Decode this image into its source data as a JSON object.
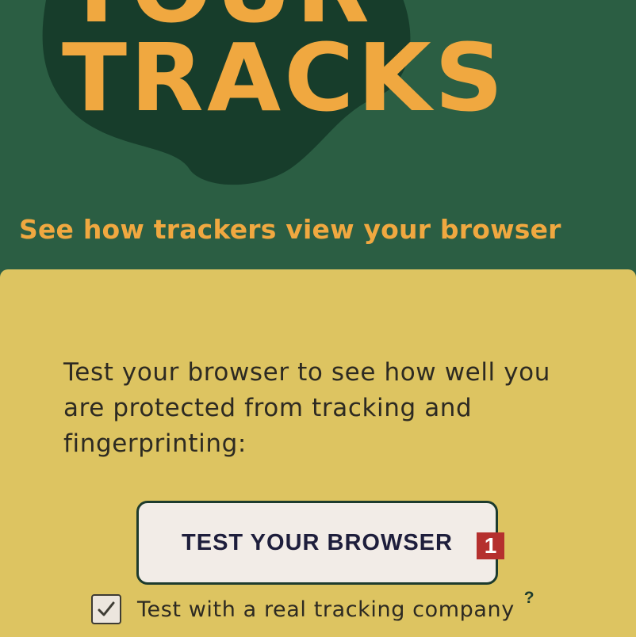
{
  "hero": {
    "title_line1": "YOUR",
    "title_line2": "TRACKS",
    "subtitle": "See how trackers view your browser"
  },
  "panel": {
    "description": "Test your browser to see how well you are protected from tracking and fingerprinting:",
    "test_button_label": "TEST YOUR BROWSER",
    "marker_label": "1",
    "checkbox": {
      "checked": true,
      "label": "Test with a real tracking company",
      "help": "?"
    }
  },
  "colors": {
    "background_green": "#2b5e43",
    "paw_dark_green": "#173d2b",
    "accent_orange": "#f0a840",
    "panel_yellow": "#ddc461",
    "button_bg": "#f2ece7",
    "marker_red": "#b5302e"
  },
  "icons": {
    "background_art": "paw-print",
    "checkbox_mark": "checkmark"
  }
}
